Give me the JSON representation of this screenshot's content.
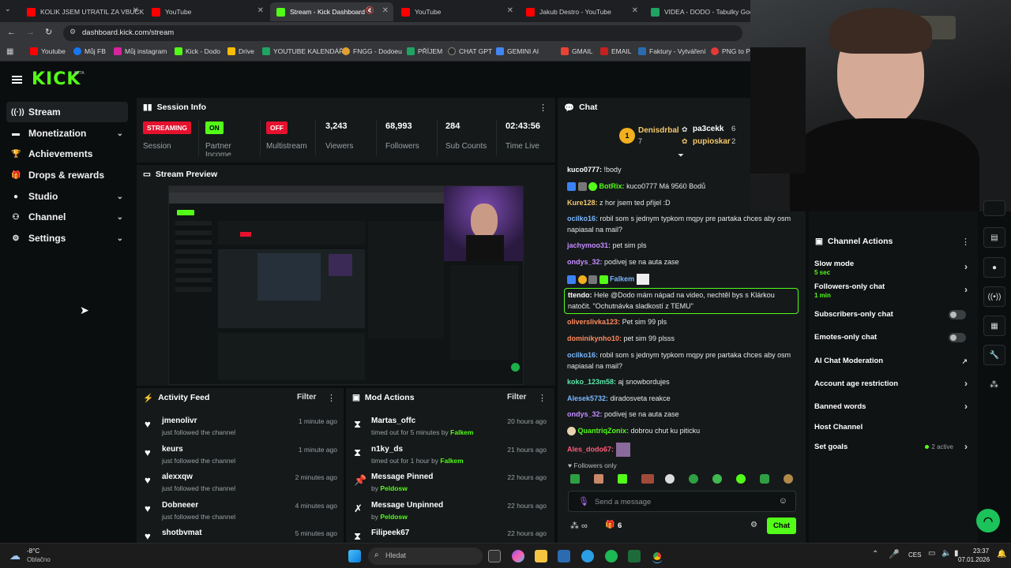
{
  "browser": {
    "tabs": [
      {
        "title": "KOLIK JSEM UTRATIL ZA VBUCK",
        "active": false
      },
      {
        "title": "YouTube",
        "active": false
      },
      {
        "title": "Stream - Kick Dashboard",
        "active": true
      },
      {
        "title": "YouTube",
        "active": false
      },
      {
        "title": "Jakub Destro - YouTube",
        "active": false
      },
      {
        "title": "VIDEA - DODO - Tabulky Goog",
        "active": false
      }
    ],
    "url": "dashboard.kick.com/stream",
    "bookmarks": [
      "Youtube",
      "Můj FB",
      "Můj instagram",
      "Kick - Dodo",
      "Drive",
      "YOUTUBE KALENDÁŘ",
      "FNGG - Dodoeu",
      "PŘÍJEM",
      "CHAT GPT",
      "GEMINI AI",
      "GMAIL",
      "EMAIL",
      "Faktury - Vytváření",
      "PNG to PD"
    ]
  },
  "brand": {
    "logo": "KICK",
    "beta": "BETA",
    "accent": "#53fc18"
  },
  "sidebar": {
    "items": [
      {
        "label": "Stream",
        "icon": "stream-icon"
      },
      {
        "label": "Monetization",
        "icon": "monetization-icon"
      },
      {
        "label": "Achievements",
        "icon": "trophy-icon"
      },
      {
        "label": "Drops & rewards",
        "icon": "gift-icon"
      },
      {
        "label": "Studio",
        "icon": "studio-icon"
      },
      {
        "label": "Channel",
        "icon": "channel-icon"
      },
      {
        "label": "Settings",
        "icon": "gear-icon"
      }
    ]
  },
  "session": {
    "title": "Session Info",
    "status_badge": "STREAMING",
    "status_label": "Session",
    "partner_badge": "ON",
    "partner_label": "Partner Income",
    "multistream_badge": "OFF",
    "multistream_label": "Multistream",
    "viewers": "3,243",
    "viewers_label": "Viewers",
    "followers": "68,993",
    "followers_label": "Followers",
    "subs": "284",
    "subs_label": "Sub Counts",
    "time": "02:43:56",
    "time_label": "Time Live"
  },
  "preview": {
    "title": "Stream Preview"
  },
  "activity": {
    "title": "Activity Feed",
    "filter": "Filter",
    "rows": [
      {
        "name": "jmenolivr",
        "sub": "just followed the channel",
        "time": "1 minute ago"
      },
      {
        "name": "keurs",
        "sub": "just followed the channel",
        "time": "1 minute ago"
      },
      {
        "name": "alexxqw",
        "sub": "just followed the channel",
        "time": "2 minutes ago"
      },
      {
        "name": "Dobneeer",
        "sub": "just followed the channel",
        "time": "4 minutes ago"
      },
      {
        "name": "shotbvmat",
        "sub": "",
        "time": "5 minutes ago"
      }
    ]
  },
  "modactions": {
    "title": "Mod Actions",
    "filter": "Filter",
    "rows": [
      {
        "name": "Martas_offc",
        "sub": "timed out for 5 minutes by",
        "by": "Falkem",
        "time": "20 hours ago"
      },
      {
        "name": "n1ky_ds",
        "sub": "timed out for 1 hour by",
        "by": "Falkem",
        "time": "21 hours ago"
      },
      {
        "name": "Message Pinned",
        "sub": "by",
        "by": "Peldosw",
        "time": "22 hours ago"
      },
      {
        "name": "Message Unpinned",
        "sub": "by",
        "by": "Peldosw",
        "time": "22 hours ago"
      },
      {
        "name": "Filipeek67",
        "sub": "",
        "by": "",
        "time": "22 hours ago"
      }
    ]
  },
  "chat": {
    "title": "Chat",
    "top_gifters": [
      {
        "name": "Denisdrbal",
        "count": "7",
        "rank": "1"
      },
      {
        "name": "pa3cekk",
        "count": "6"
      },
      {
        "name": "pupioskar",
        "count": "2"
      }
    ],
    "messages": [
      {
        "user": "kuco0777:",
        "text": "!body",
        "color": "#ffffff"
      },
      {
        "user": "BotRix:",
        "text": "kuco0777 Má 9560 Bodů",
        "color": "#53fc18"
      },
      {
        "user": "Kure128:",
        "text": "z hor jsem ted přijel :D",
        "color": "#f5c86b"
      },
      {
        "user": "ocilko16:",
        "text": "robil som s jednym typkom mqpy pre partaka chces aby osm napiasal na mail?",
        "color": "#7ab8ff"
      },
      {
        "user": "jachymoo31:",
        "text": "pet sim pls",
        "color": "#c58cff"
      },
      {
        "user": "ondys_32:",
        "text": "podivej se na auta zase",
        "color": "#c58cff"
      },
      {
        "user": "Falkem",
        "text": "",
        "color": "#7ab8ff"
      },
      {
        "user": "ttendo:",
        "text": "Hele @Dodo mám nápad na video, nechtěl bys s Klárkou natočit. \"Ochutnávka sladkostí z TEMU\"",
        "color": "#ffffff"
      },
      {
        "user": "oliverslivka123:",
        "text": "Pet sim 99 pls",
        "color": "#ff8a5c"
      },
      {
        "user": "dominikynho10:",
        "text": "pet sim 99 plsss",
        "color": "#ff8a5c"
      },
      {
        "user": "ocilko16:",
        "text": "robil som s jednym typkom mqpy pre partaka chces aby osm napiasal na mail?",
        "color": "#7ab8ff"
      },
      {
        "user": "koko_123m58:",
        "text": "aj snowbordujes",
        "color": "#5ce6a8"
      },
      {
        "user": "Alesek5732:",
        "text": "diradosveta reakce",
        "color": "#7ab8ff"
      },
      {
        "user": "ondys_32:",
        "text": "podivej se na auta zase",
        "color": "#c58cff"
      },
      {
        "user": "QuantriqZonix:",
        "text": "dobrou chut ku piticku",
        "color": "#53fc18"
      },
      {
        "user": "Ales_dodo67:",
        "text": "",
        "color": "#ff5c7a"
      }
    ],
    "followers_only": "Followers only",
    "placeholder": "Send a message",
    "send": "Chat",
    "points": "6"
  },
  "channel_actions": {
    "title": "Channel Actions",
    "items": [
      {
        "label": "Slow mode",
        "sub": "5 sec",
        "kind": "chevron"
      },
      {
        "label": "Followers-only chat",
        "sub": "1 min",
        "kind": "chevron"
      },
      {
        "label": "Subscribers-only chat",
        "sub": "",
        "kind": "toggle"
      },
      {
        "label": "Emotes-only chat",
        "sub": "",
        "kind": "toggle"
      },
      {
        "label": "AI Chat Moderation",
        "sub": "",
        "kind": "external"
      },
      {
        "label": "Account age restriction",
        "sub": "",
        "kind": "chevron"
      },
      {
        "label": "Banned words",
        "sub": "",
        "kind": "chevron"
      },
      {
        "label": "Host Channel",
        "sub": "",
        "kind": "none"
      },
      {
        "label": "Set goals",
        "sub": "2 active",
        "kind": "chevron"
      }
    ]
  },
  "taskbar": {
    "weather_temp": "-8°C",
    "weather_desc": "Oblačno",
    "search": "Hledat",
    "lang": "CES",
    "time": "23:37",
    "date": "07.01.2026"
  }
}
